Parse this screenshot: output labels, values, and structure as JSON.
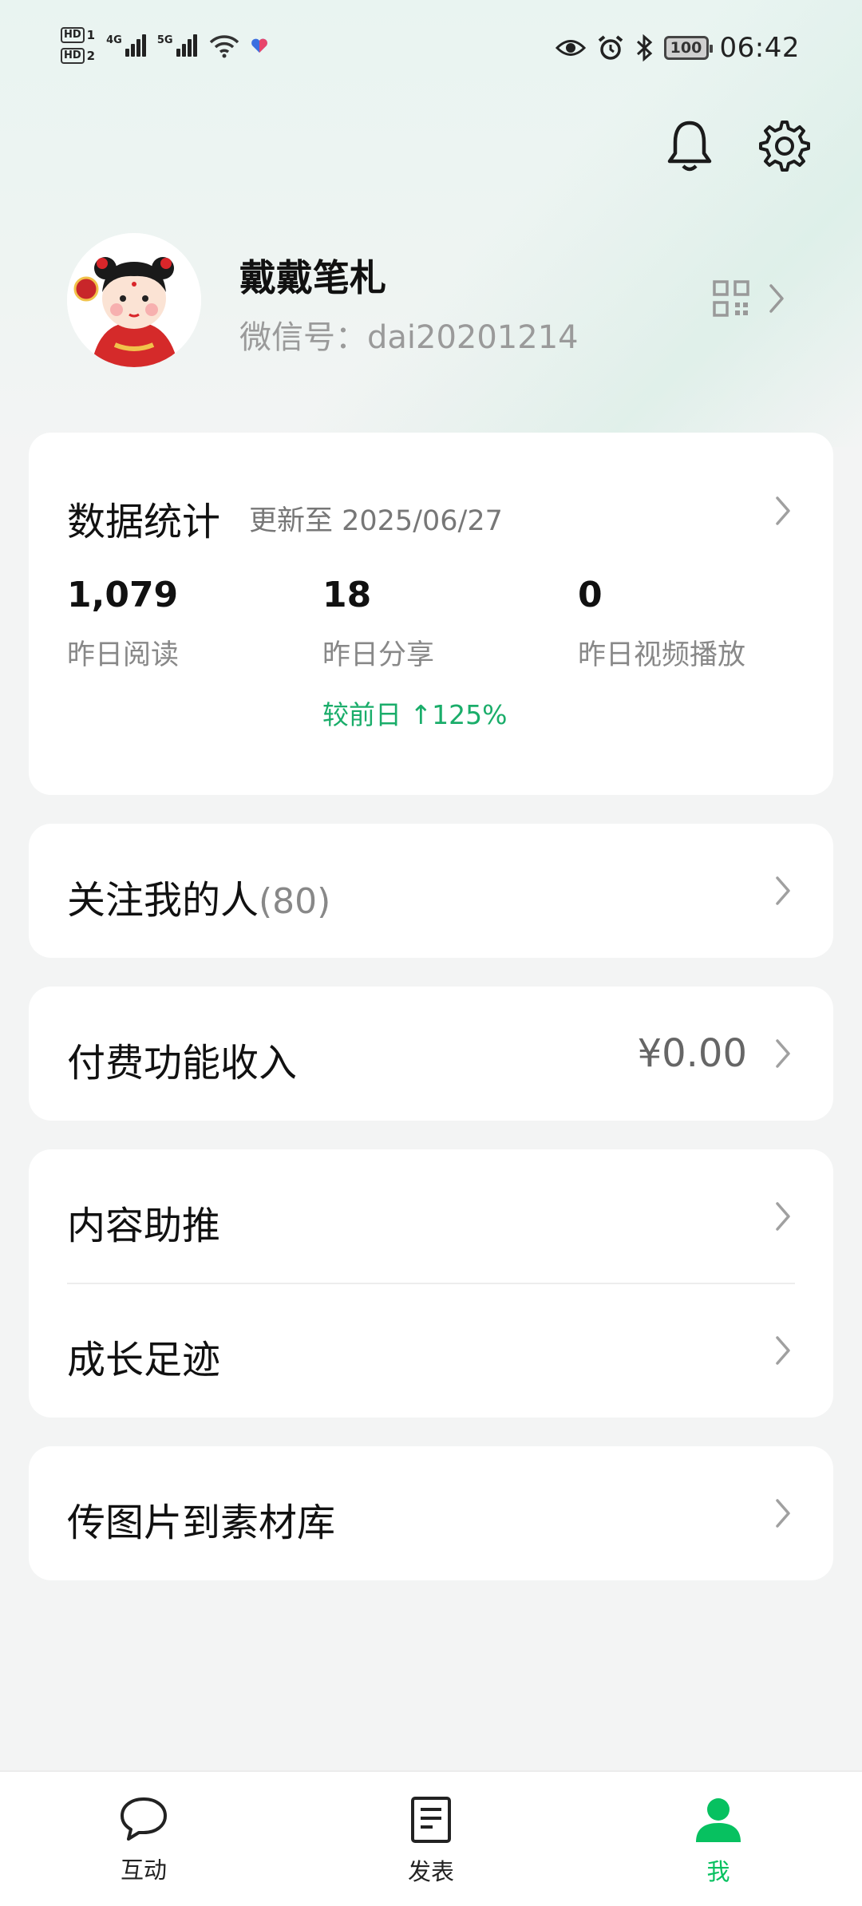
{
  "status_bar": {
    "hd1": "HD",
    "hd1_index": "1",
    "hd2": "HD",
    "hd2_index": "2",
    "net1": "4G",
    "net2": "5G",
    "battery": "100",
    "time": "06:42"
  },
  "header": {
    "notification_icon": "bell-icon",
    "settings_icon": "gear-icon"
  },
  "profile": {
    "name": "戴戴笔札",
    "wechat_id": "微信号：dai20201214",
    "qr_icon": "qr-code-icon"
  },
  "stats": {
    "title": "数据统计",
    "updated": "更新至 2025/06/27",
    "items": [
      {
        "value": "1,079",
        "label": "昨日阅读",
        "delta": ""
      },
      {
        "value": "18",
        "label": "昨日分享",
        "delta": "较前日 ↑125%"
      },
      {
        "value": "0",
        "label": "昨日视频播放",
        "delta": ""
      }
    ]
  },
  "followers": {
    "label": "关注我的人",
    "count": "(80)"
  },
  "income": {
    "label": "付费功能收入",
    "value": "¥0.00"
  },
  "menu": {
    "content_promo": "内容助推",
    "growth": "成长足迹",
    "upload": "传图片到素材库"
  },
  "tab_bar": {
    "tabs": [
      {
        "label": "互动",
        "icon": "chat-bubble-icon",
        "active": false
      },
      {
        "label": "发表",
        "icon": "document-icon",
        "active": false
      },
      {
        "label": "我",
        "icon": "person-icon",
        "active": true
      }
    ]
  },
  "colors": {
    "accent": "#07c160",
    "delta_green": "#1aad6a",
    "background": "#f3f4f4"
  }
}
